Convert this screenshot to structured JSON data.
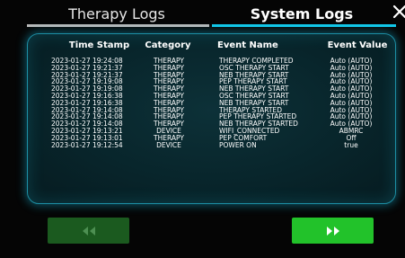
{
  "tabs": {
    "therapy_logs": "Therapy  Logs",
    "system_logs": "System  Logs"
  },
  "log_table": {
    "headers": {
      "timestamp": "Time Stamp",
      "category": "Category",
      "event_name": "Event Name",
      "event_value": "Event Value"
    },
    "rows": [
      {
        "timestamp": "2023-01-27 19:24:08",
        "category": "THERAPY",
        "event_name": "THERAPY COMPLETED",
        "event_value": "Auto (AUTO)"
      },
      {
        "timestamp": "2023-01-27 19:21:37",
        "category": "THERAPY",
        "event_name": "OSC THERAPY START",
        "event_value": "Auto (AUTO)"
      },
      {
        "timestamp": "2023-01-27 19:21:37",
        "category": "THERAPY",
        "event_name": "NEB THERAPY START",
        "event_value": "Auto (AUTO)"
      },
      {
        "timestamp": "2023-01-27 19:19:08",
        "category": "THERAPY",
        "event_name": "PEP THERAPY START",
        "event_value": "Auto (AUTO)"
      },
      {
        "timestamp": "2023-01-27 19:19:08",
        "category": "THERAPY",
        "event_name": "NEB THERAPY START",
        "event_value": "Auto (AUTO)"
      },
      {
        "timestamp": "2023-01-27 19:16:38",
        "category": "THERAPY",
        "event_name": "OSC THERAPY START",
        "event_value": "Auto (AUTO)"
      },
      {
        "timestamp": "2023-01-27 19:16:38",
        "category": "THERAPY",
        "event_name": "NEB THERAPY START",
        "event_value": "Auto (AUTO)"
      },
      {
        "timestamp": "2023-01-27 19:14:08",
        "category": "THERAPY",
        "event_name": "THERAPY STARTED",
        "event_value": "Auto (AUTO)"
      },
      {
        "timestamp": "2023-01-27 19:14:08",
        "category": "THERAPY",
        "event_name": "PEP THERAPY STARTED",
        "event_value": "Auto (AUTO)"
      },
      {
        "timestamp": "2023-01-27 19:14:08",
        "category": "THERAPY",
        "event_name": "NEB THERAPY STARTED",
        "event_value": "Auto (AUTO)"
      },
      {
        "timestamp": "2023-01-27 19:13:21",
        "category": "DEVICE",
        "event_name": "WIFI_CONNECTED",
        "event_value": "ABMRC"
      },
      {
        "timestamp": "2023-01-27 19:13:01",
        "category": "THERAPY",
        "event_name": "PEP COMFORT",
        "event_value": "Off"
      },
      {
        "timestamp": "2023-01-27 19:12:54",
        "category": "DEVICE",
        "event_name": "POWER ON",
        "event_value": "true"
      }
    ]
  },
  "icons": {
    "close": "close-icon",
    "previous": "double-chevron-left-icon",
    "next": "double-chevron-right-icon"
  },
  "colors": {
    "active_tab_underline": "#12c8ea",
    "inactive_tab_underline": "#b9b9b9",
    "panel_glow": "#14aacd",
    "prev_button": "#1b5a1f",
    "next_button": "#22c22a"
  }
}
